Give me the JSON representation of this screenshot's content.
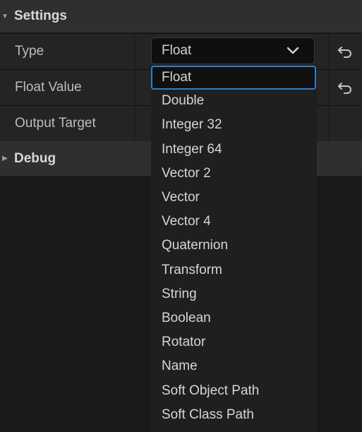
{
  "sections": {
    "settings": "Settings",
    "debug": "Debug"
  },
  "rows": {
    "type_label": "Type",
    "float_value_label": "Float Value",
    "output_target_label": "Output Target"
  },
  "type_combo": {
    "selected": "Float"
  },
  "dropdown_options": [
    "Float",
    "Double",
    "Integer 32",
    "Integer 64",
    "Vector 2",
    "Vector",
    "Vector 4",
    "Quaternion",
    "Transform",
    "String",
    "Boolean",
    "Rotator",
    "Name",
    "Soft Object Path",
    "Soft Class Path"
  ],
  "colors": {
    "accent": "#2a7fcf",
    "panel": "#242424",
    "header": "#2f2f2f"
  },
  "icons": {
    "reset": "reset-arrow-icon",
    "chevron": "chevron-down-icon",
    "collapse": "triangle-icon"
  }
}
